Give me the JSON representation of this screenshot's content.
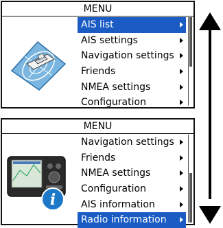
{
  "menu1": {
    "title": "MENU",
    "items": [
      {
        "label": "AIS list",
        "selected": true
      },
      {
        "label": "AIS settings"
      },
      {
        "label": "Navigation settings"
      },
      {
        "label": "Friends"
      },
      {
        "label": "NMEA settings"
      },
      {
        "label": "Configuration"
      }
    ],
    "icon": "ais-radar-boat-icon"
  },
  "menu2": {
    "title": "MENU",
    "items": [
      {
        "label": "Navigation settings"
      },
      {
        "label": "Friends"
      },
      {
        "label": "NMEA settings"
      },
      {
        "label": "Configuration"
      },
      {
        "label": "AIS information"
      },
      {
        "label": "Radio information",
        "selected": true
      }
    ],
    "icon": "radio-info-icon"
  },
  "colors": {
    "selection": "#1a5cc4"
  }
}
